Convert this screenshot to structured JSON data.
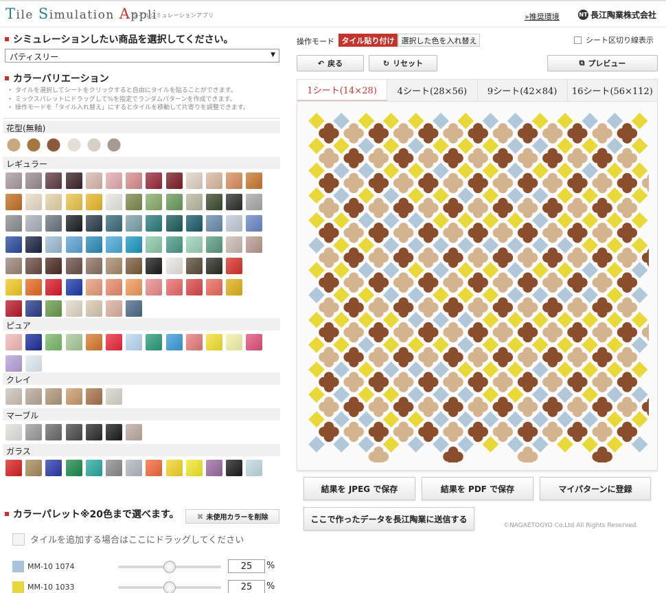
{
  "header": {
    "logo_parts": [
      "T",
      "ile ",
      "S",
      "imulation ",
      "A",
      "ppli"
    ],
    "subtitle": "タイルシミュレーションアプリ",
    "env_link": "»推奨環境",
    "company_mark": "NT",
    "company": "長江陶業株式会社"
  },
  "product": {
    "title": "シミュレーションしたい商品を選択してください。",
    "selected": "パティスリー"
  },
  "variation": {
    "title": "カラーバリエーション",
    "notes": [
      "タイルを選択してシートをクリックすると自由にタイルを貼ることができます。",
      "ミックスパレットにドラッグして%を指定でランダムパターンを作成できます。",
      "操作モードを「タイル入れ替え」にするとタイルを移動して片寄りを調整できます。"
    ],
    "groups": [
      {
        "label": "花型(無釉)",
        "flower": true,
        "colors": [
          "#c9a880",
          "#a6763f",
          "#8a5a3a",
          "#e6ddd4",
          "#d6cfc8",
          "#a89a92"
        ]
      },
      {
        "label": "レギュラー",
        "flower": false,
        "colors": [
          "#a89aa0",
          "#9a8a92",
          "#5e3c42",
          "#3a2228",
          "#d9b7ae",
          "#e2aab0",
          "#d98c8c",
          "#962a3a",
          "#7a1e24",
          "#e0d2c4",
          "#d8b8a0",
          "#d98c5c",
          "#c87830",
          "#c27020",
          "#e9dcc6",
          "#e3d3a6",
          "#e8c34a",
          "#e8b828",
          "#e8e8e2",
          "#7a8a4a",
          "#8aaa6a",
          "#6a9a5a",
          "#b8b8a0",
          "#3a4a2a",
          "#2a2e28",
          "#a8a8a8",
          "#8a8c8e",
          "#a9b0b8",
          "#6a7380",
          "#1a1c20",
          "#2a3a4a",
          "#3a6a7a",
          "#7aa0a8",
          "#2a7a7a",
          "#1a5a5a",
          "#1a5a6a",
          "#6a8aaa",
          "#c0cad8",
          "#6a86c8",
          "#2a4a9a",
          "#1a2240",
          "#9abad2",
          "#5aa2d2",
          "#2a8ab8",
          "#4aa8d8",
          "#1a98c0",
          "#8ac8a8",
          "#4a9888",
          "#9ad0b8",
          "#5a9a80",
          "#c8bab0",
          "#b89a90",
          "#9a8478",
          "#6a4a42",
          "#4a2a22",
          "#6a4e46",
          "#8a7060",
          "#a68a6a",
          "#7a5a3a",
          "#1a1a1a",
          "#e8e6e4",
          "#5a4a3a",
          "#2a2a22",
          "#d83028",
          "#f2c820",
          "#e86820",
          "#d81828",
          "#1a3aa8",
          "#e89a7a",
          "#e88a6a",
          "#f29858",
          "#e88a8a",
          "#e86a6a",
          "#d84848",
          "#e86a5a",
          "#e0b018",
          "#b81828",
          "#2a3a8a",
          "#6a9a4a",
          "#e0d8c8",
          "#d8c8b0",
          "#d8b0a0",
          "#4a6a88"
        ],
        "rows": [
          13,
          13,
          13,
          13,
          12,
          12,
          8
        ]
      },
      {
        "label": "ピュア",
        "flower": false,
        "colors": [
          "#f2b8b8",
          "#1a2a9a",
          "#7ab868",
          "#a8c898",
          "#d8782a",
          "#e8283a",
          "#b8d8f2",
          "#2a9a78",
          "#3a9ad8",
          "#e87a7a",
          "#f2e030",
          "#f2f2a8",
          "#e0507a",
          "#b8a0d8",
          "#e0eaf2"
        ],
        "rows": [
          13,
          2
        ]
      },
      {
        "label": "クレイ",
        "flower": false,
        "colors": [
          "#cbc2b6",
          "#b8a898",
          "#b0967a",
          "#c89a6a",
          "#a8724a",
          "#d8d4c8"
        ],
        "rows": [
          6
        ]
      },
      {
        "label": "マーブル",
        "flower": false,
        "colors": [
          "#e2e0dc",
          "#9a9a9a",
          "#6a6a6a",
          "#4a4a4a",
          "#2a2a2a",
          "#1a1a1a",
          "#bcaaa0"
        ],
        "rows": [
          7
        ]
      },
      {
        "label": "ガラス",
        "flower": false,
        "colors": [
          "#d82020",
          "#a88a5a",
          "#2a3aa8",
          "#1a8a4a",
          "#2aa8a0",
          "#8a8a8a",
          "#b0b8c0",
          "#f26838",
          "#f2d428",
          "#f2e828",
          "#9a6aa0",
          "#1a1a1a",
          "#c0d8e0"
        ],
        "rows": [
          13,
          2
        ]
      }
    ]
  },
  "color_palette": {
    "title": "カラーパレット※20色まで選べます。",
    "delete_button": "未使用カラーを削除",
    "drop_hint": "タイルを追加する場合はここにドラッグしてください",
    "items": [
      {
        "name": "MM-10 1074",
        "color": "#a8c4d8",
        "value": "25",
        "level": 0.5
      },
      {
        "name": "MM-10 1033",
        "color": "#e8d840",
        "value": "25",
        "level": 0.5
      }
    ],
    "unit": "%"
  },
  "mode": {
    "label": "操作モード",
    "options": [
      "タイル貼り付け",
      "選択した色を入れ替え"
    ],
    "active": 0,
    "sheet_line": "シート区切り線表示",
    "sheet_line_checked": false
  },
  "actions": {
    "back": "戻る",
    "reset": "リセット",
    "preview": "プレビュー"
  },
  "tabs": [
    "1シート(14×28)",
    "4シート(28×56)",
    "9シート(42×84)",
    "16シート(56×112)"
  ],
  "active_tab": 0,
  "mosaic": {
    "flower_colors": [
      "#8a4e2c",
      "#d4b48e"
    ],
    "diamond_colors": [
      "#e8d83a",
      "#b0c8da"
    ]
  },
  "buttons": {
    "save_jpeg": "結果を JPEG で保存",
    "save_pdf": "結果を PDF で保存",
    "register": "マイパターンに登録",
    "send": "ここで作ったデータを長江陶業に送信する"
  },
  "copyright": "©NAGAETOGYO Co.Ltd All Rights Reserved."
}
